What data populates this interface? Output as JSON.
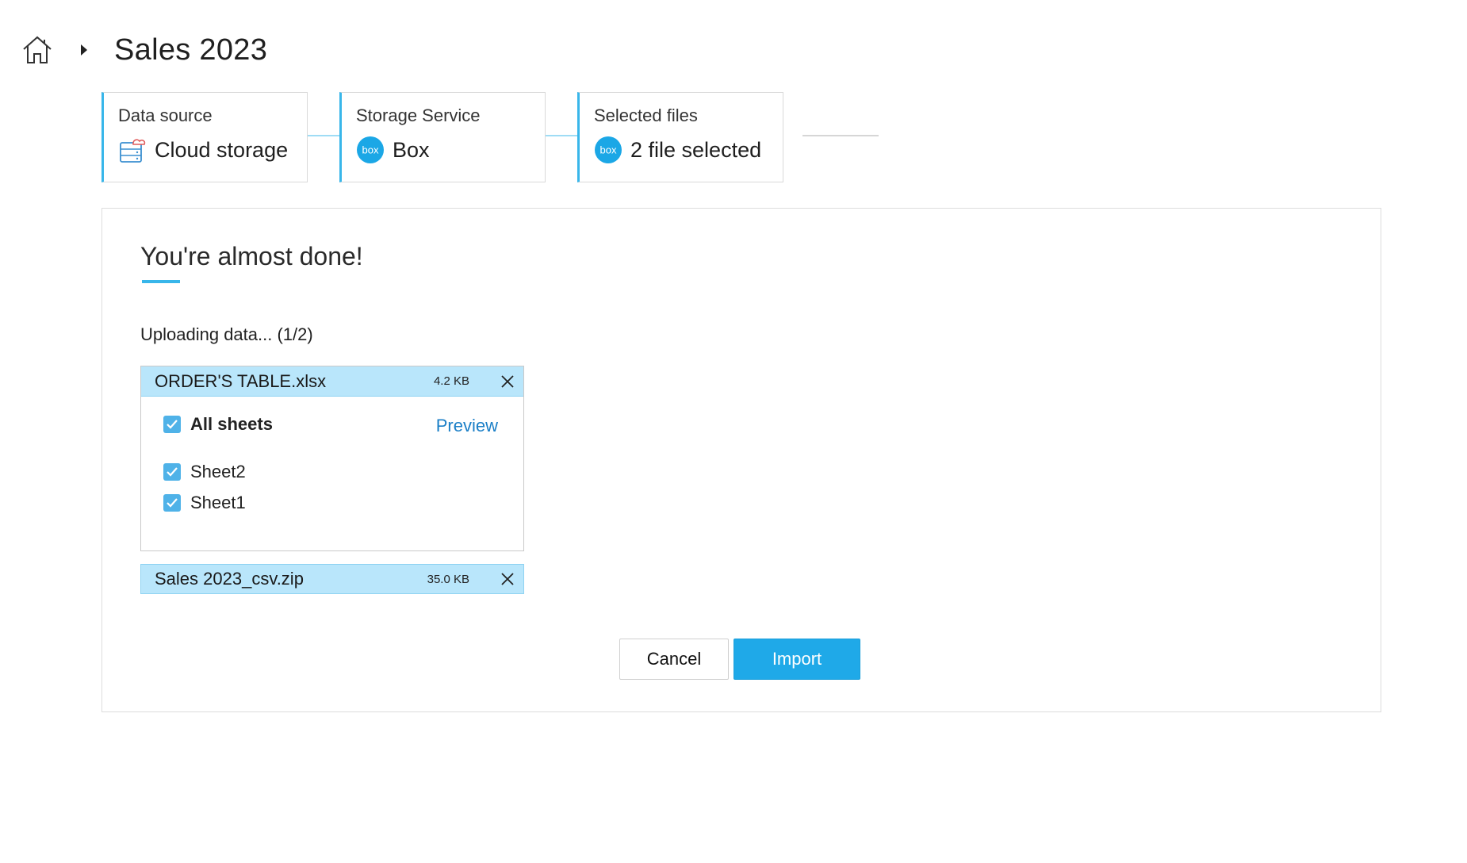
{
  "breadcrumb": {
    "home_icon": "home-icon",
    "separator_icon": "caret-right-icon",
    "title": "Sales 2023"
  },
  "steps": [
    {
      "label": "Data source",
      "value": "Cloud storage",
      "icon": "cloud-storage-icon"
    },
    {
      "label": "Storage Service",
      "value": "Box",
      "icon": "box-logo-icon"
    },
    {
      "label": "Selected files",
      "value": "2 file selected",
      "icon": "box-logo-icon"
    }
  ],
  "panel": {
    "title": "You're almost done!",
    "status": "Uploading data... (1/2)",
    "files": [
      {
        "name": "ORDER'S TABLE.xlsx",
        "size": "4.2 KB",
        "expanded": true,
        "preview_label": "Preview",
        "sheets": [
          {
            "label": "All sheets",
            "checked": true
          },
          {
            "label": "Sheet2",
            "checked": true
          },
          {
            "label": "Sheet1",
            "checked": true
          }
        ]
      },
      {
        "name": "Sales 2023_csv.zip",
        "size": "35.0 KB",
        "expanded": false
      }
    ],
    "cancel_label": "Cancel",
    "import_label": "Import"
  },
  "colors": {
    "accent": "#38b6ea",
    "file_header_bg": "#b9e6fb",
    "import_button": "#1fa9e8",
    "link": "#1b7fc7",
    "checkbox": "#4fb2e8"
  }
}
